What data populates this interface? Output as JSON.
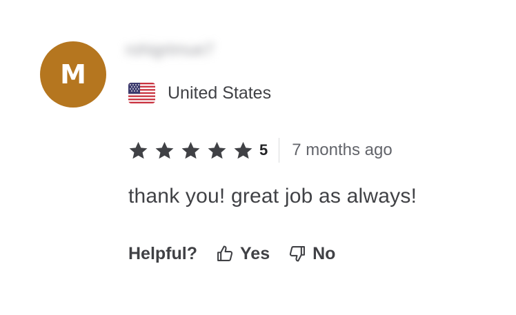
{
  "review": {
    "avatar_letter": "M",
    "avatar_color": "#b5761f",
    "username": "rohigrtmue7",
    "country": "United States",
    "flag_icon": "us-flag-icon",
    "rating": {
      "stars": 5,
      "max_stars": 5,
      "score_label": "5",
      "star_color": "#404145"
    },
    "time_ago": "7 months ago",
    "text": "thank you! great job as always!"
  },
  "helpful": {
    "label": "Helpful?",
    "yes_label": "Yes",
    "yes_icon": "thumbs-up-icon",
    "no_label": "No",
    "no_icon": "thumbs-down-icon"
  }
}
